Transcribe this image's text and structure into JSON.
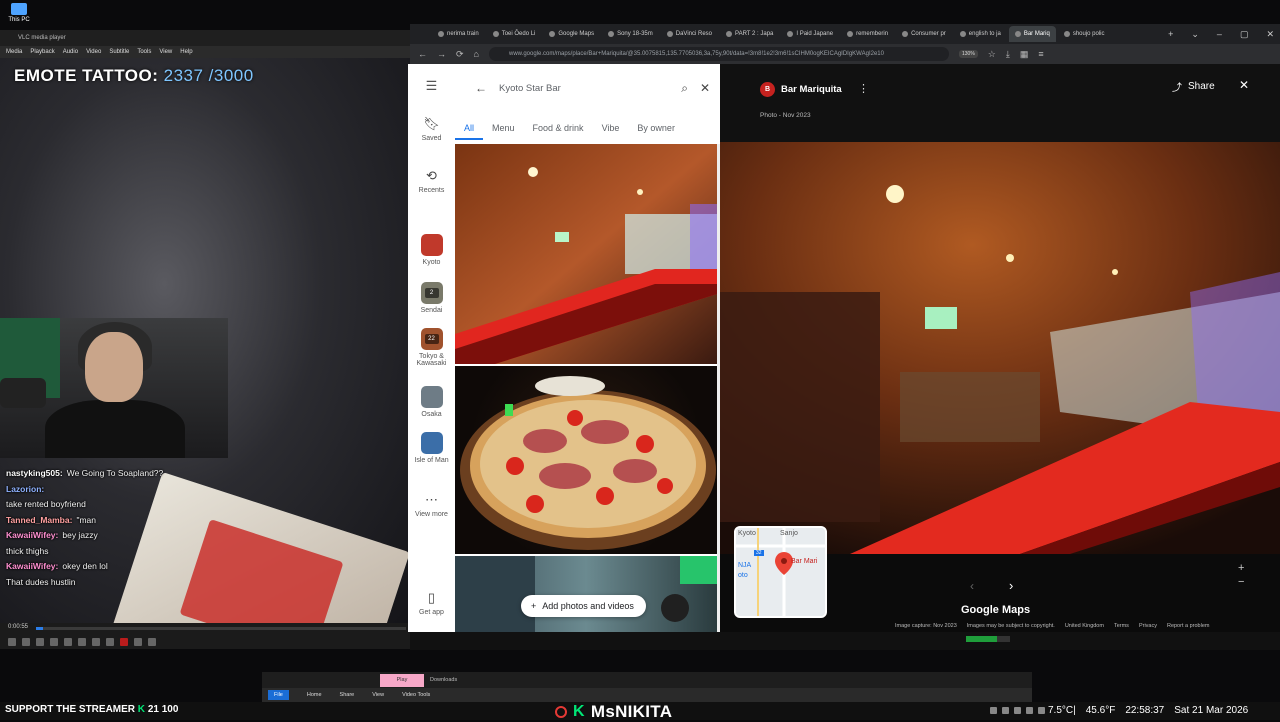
{
  "desktop": {
    "icon_label": "This PC"
  },
  "stream": {
    "emote_label": "EMOTE TATTOO:",
    "emote_count": "2337 /3000",
    "chat": [
      {
        "user": "nastyking505",
        "user_color": "#ffffff",
        "msg": "We Going To Soapland??"
      },
      {
        "user": "Lazorion",
        "user_color": "#8fb2ff",
        "msg": ""
      },
      {
        "user": "",
        "user_color": "#ffffff",
        "msg": "take rented boyfriend"
      },
      {
        "user": "Tanned_Mamba",
        "user_color": "#ffa0a0",
        "msg": "\"man"
      },
      {
        "user": "KawaiiWifey",
        "user_color": "#ff8fd0",
        "msg": "bey jazzy"
      },
      {
        "user": "",
        "user_color": "#ffffff",
        "msg": "thick thighs"
      },
      {
        "user": "KawaiiWifey",
        "user_color": "#ff8fd0",
        "msg": "okey den lol"
      },
      {
        "user": "",
        "user_color": "#ffffff",
        "msg": "That dudes hustlin"
      }
    ],
    "support_text": "SUPPORT THE STREAMER",
    "support_k": "K",
    "support_count": "21 100",
    "brand_k": "K",
    "brand_name": "MsNIKITA"
  },
  "vlc": {
    "menus": [
      "Media",
      "Playback",
      "Audio",
      "Video",
      "Subtitle",
      "Tools",
      "View",
      "Help"
    ],
    "title": "VLC media player",
    "time": "0:00:55",
    "progress": 0.02
  },
  "browser": {
    "tabs": [
      {
        "label": "nerima train"
      },
      {
        "label": "Toei Ōedo Li"
      },
      {
        "label": "Google Maps"
      },
      {
        "label": "Sony 18-35m"
      },
      {
        "label": "DaVinci Reso"
      },
      {
        "label": "PART 2 : Japa"
      },
      {
        "label": "I Paid Japane"
      },
      {
        "label": "rememberin"
      },
      {
        "label": "Consumer pr"
      },
      {
        "label": "english to ja"
      },
      {
        "label": "Bar Mariq"
      },
      {
        "label": "shoujo polic"
      }
    ],
    "active_tab": 10,
    "url": "www.google.com/maps/place/Bar+Mariquita/@35.0075815,135.7705036,3a,75y,90t/data=!3m8!1e2!3m6!1sCIHM0ogKEICAgIDIgKWAgI2e10",
    "zoom": "130%"
  },
  "maps": {
    "rail": [
      {
        "label": "Saved",
        "icon": "bookmark-icon"
      },
      {
        "label": "Recents",
        "icon": "history-icon"
      },
      {
        "label": "Kyoto",
        "badge": "",
        "color": "#c0392b"
      },
      {
        "label": "Sendai",
        "badge": "2",
        "color": "#7a7a6a"
      },
      {
        "label": "Tokyo & Kawasaki",
        "badge": "22",
        "color": "#a0522d"
      },
      {
        "label": "Osaka",
        "badge": "",
        "color": "#6e7c86"
      },
      {
        "label": "Isle of Man",
        "badge": "",
        "color": "#3b6ea8"
      },
      {
        "label": "View more",
        "icon": "more-icon"
      },
      {
        "label": "Get app",
        "icon": "phone-icon"
      }
    ],
    "search_query": "Kyoto Star Bar",
    "filter_tabs": [
      "All",
      "Menu",
      "Food & drink",
      "Vibe",
      "By owner"
    ],
    "add_photos": "Add photos and videos"
  },
  "viewer": {
    "place_initial": "B",
    "place_name": "Bar Mariquita",
    "photo_date": "Photo - Nov 2023",
    "share": "Share",
    "minimap": {
      "label_kyoto": "Kyoto",
      "label_sanjo": "Sanjo",
      "label_nja": "NJA",
      "label_oto": "oto",
      "pin_label": "Bar Mari",
      "route": "32"
    },
    "logo": "Google Maps",
    "footer": [
      "Image capture: Nov 2023",
      "Images may be subject to copyright.",
      "United Kingdom",
      "Terms",
      "Privacy",
      "Report a problem"
    ]
  },
  "explorer": {
    "play": "Play",
    "downloads": "Downloads",
    "ribbon": [
      "File",
      "Home",
      "Share",
      "View",
      "Video Tools"
    ]
  },
  "system": {
    "temp": "7.5°C|",
    "temp2": "45.6°F",
    "time": "22:58:37",
    "date": "Sat 21 Mar 2026"
  },
  "colors": {
    "accent": "#1a73e8",
    "kick_green": "#00e676",
    "vlc_blue": "#2b7de9",
    "place_red": "#c5221f"
  }
}
